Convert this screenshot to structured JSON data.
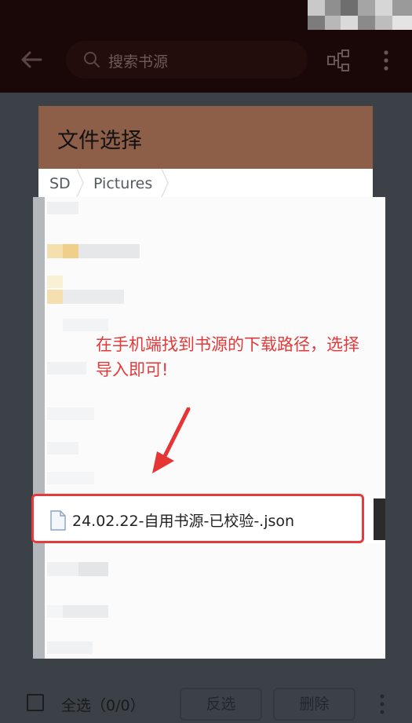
{
  "app_bar": {
    "search_placeholder": "搜索书源"
  },
  "dialog": {
    "title": "文件选择",
    "breadcrumb": [
      "SD",
      "Pictures"
    ],
    "annotation": "在手机端找到书源的下载路径，选择导入即可!",
    "highlighted_file": "24.02.22-自用书源-已校验-.json"
  },
  "bottom_bar": {
    "select_all_label": "全选（0/0）",
    "invert_label": "反选",
    "delete_label": "删除"
  },
  "colors": {
    "dialog_header": "#8e5f48",
    "annotation": "#e23a3a",
    "highlight_border": "#e43c3c"
  },
  "icons": [
    "back-arrow-icon",
    "search-icon",
    "tree-icon",
    "more-vert-icon",
    "file-icon",
    "arrow-icon"
  ]
}
